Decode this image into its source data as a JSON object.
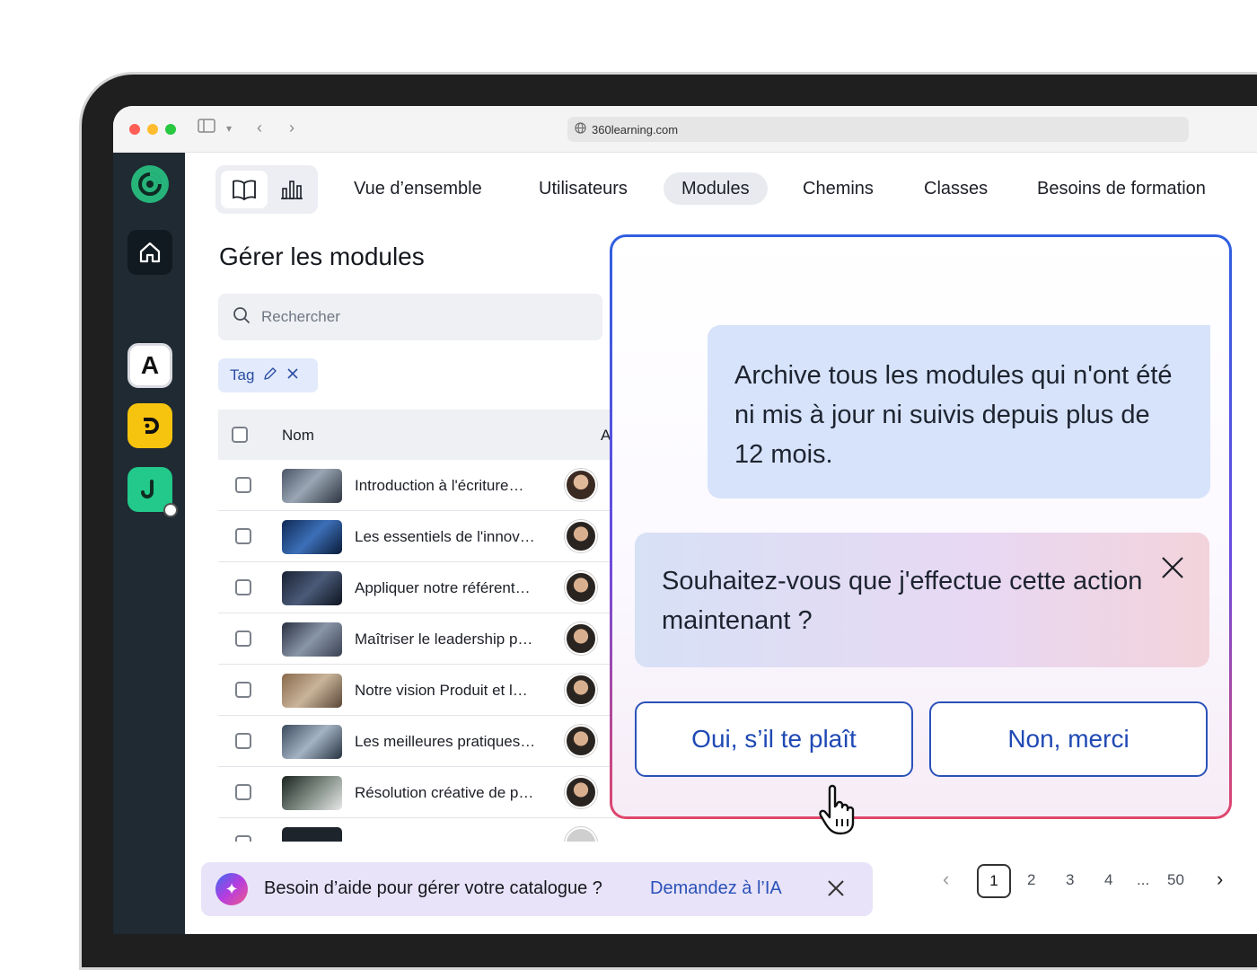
{
  "browser": {
    "url": "360learning.com"
  },
  "app_sidebar": {
    "apps": [
      "A"
    ]
  },
  "top_nav": {
    "items": [
      {
        "label": "Vue d’ensemble",
        "active": false
      },
      {
        "label": "Utilisateurs",
        "active": false
      },
      {
        "label": "Modules",
        "active": true
      },
      {
        "label": "Chemins",
        "active": false
      },
      {
        "label": "Classes",
        "active": false
      },
      {
        "label": "Besoins de formation",
        "active": false
      }
    ]
  },
  "page": {
    "title": "Gérer les modules",
    "search_placeholder": "Rechercher",
    "filter_tag": "Tag",
    "table": {
      "columns": [
        "Nom",
        "A"
      ],
      "rows": [
        {
          "name": "Introduction à l'écriture…"
        },
        {
          "name": "Les essentiels de l'innov…"
        },
        {
          "name": "Appliquer notre référent…"
        },
        {
          "name": "Maîtriser le leadership p…"
        },
        {
          "name": "Notre vision Produit et l…"
        },
        {
          "name": "Les meilleures pratiques…"
        },
        {
          "name": "Résolution créative de p…"
        }
      ]
    }
  },
  "ai_banner": {
    "text": "Besoin d’aide pour gérer votre catalogue ?",
    "link": "Demandez à l’IA"
  },
  "pagination": {
    "pages": [
      "1",
      "2",
      "3",
      "4",
      "...",
      "50"
    ],
    "current": "1"
  },
  "ai_dialog": {
    "user_message": "Archive tous les modules qui n'ont été ni mis à jour ni suivis depuis plus de 12 mois.",
    "assistant_message": "Souhaitez-vous que j'effectue cette action maintenant ?",
    "confirm_label": "Oui, s’il te plaît",
    "decline_label": "Non, merci"
  },
  "colors": {
    "accent": "#1f49b4",
    "sidebar": "#1f2a33",
    "brand_green": "#26b47a"
  }
}
